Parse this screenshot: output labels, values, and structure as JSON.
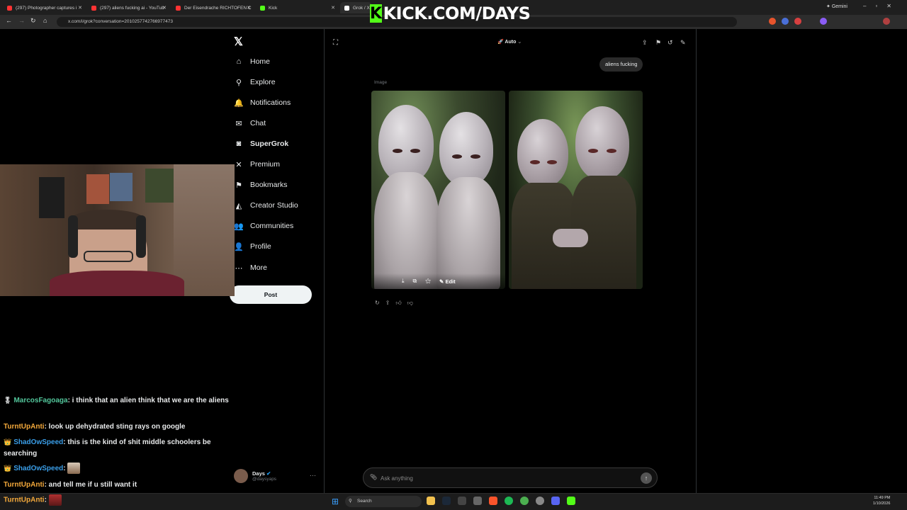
{
  "browser": {
    "tabs": [
      {
        "label": "(297) Photographer captures i",
        "color": "#ff3333"
      },
      {
        "label": "(297) aliens fucking ai - YouTub",
        "color": "#ff3333"
      },
      {
        "label": "Der Eisendrache RICHTOFEN C",
        "color": "#ff3333"
      },
      {
        "label": "Kick",
        "color": "#53fc18"
      },
      {
        "label": "Grok / X",
        "color": "#ffffff"
      }
    ],
    "url": "x.com/i/grok?conversation=2010257742766977473",
    "gemini_label": "Gemini"
  },
  "stream_overlay": {
    "banner_text": "KICK.COM/DAYS",
    "banner_k": "K"
  },
  "sidebar": {
    "logo": "𝕏",
    "items": [
      {
        "label": "Home",
        "icon": "home-icon",
        "glyph": "⌂"
      },
      {
        "label": "Explore",
        "icon": "search-icon",
        "glyph": "⚲"
      },
      {
        "label": "Notifications",
        "icon": "bell-icon",
        "glyph": "🔔"
      },
      {
        "label": "Chat",
        "icon": "mail-icon",
        "glyph": "✉"
      },
      {
        "label": "SuperGrok",
        "icon": "grok-icon",
        "glyph": "◙"
      },
      {
        "label": "Premium",
        "icon": "x-icon",
        "glyph": "✕"
      },
      {
        "label": "Bookmarks",
        "icon": "bookmark-icon",
        "glyph": "⚑"
      },
      {
        "label": "Creator Studio",
        "icon": "creator-icon",
        "glyph": "◭"
      },
      {
        "label": "Communities",
        "icon": "communities-icon",
        "glyph": "👥"
      },
      {
        "label": "Profile",
        "icon": "person-icon",
        "glyph": "👤"
      },
      {
        "label": "More",
        "icon": "more-icon",
        "glyph": "⋯"
      }
    ],
    "post_label": "Post",
    "profile": {
      "name": "Days",
      "handle": "@daysyaps"
    }
  },
  "grok": {
    "model": "Auto",
    "user_message": "aliens fucking",
    "image_label": "Image",
    "edit_label": "Edit",
    "ask_placeholder": "Ask anything"
  },
  "chat": {
    "messages": [
      {
        "user": "MarcosFagoaga",
        "color": "#53c79c",
        "badge": "🎖",
        "text": ": i think that an alien think that we are the aliens"
      },
      {
        "user": "TurntUpAnti",
        "color": "#f4a93b",
        "badge": "",
        "text": ": look up dehydrated sting rays on google"
      },
      {
        "user": "ShadOwSpeed",
        "color": "#3a9ee8",
        "badge": "👑",
        "text": ": this is the kind of shit middle schoolers be searching"
      },
      {
        "user": "ShadOwSpeed",
        "color": "#3a9ee8",
        "badge": "👑",
        "text": ":"
      },
      {
        "user": "TurntUpAnti",
        "color": "#f4a93b",
        "badge": "",
        "text": ": and tell me if u still want it"
      },
      {
        "user": "TurntUpAnti",
        "color": "#f4a93b",
        "badge": "",
        "text": ":"
      }
    ]
  },
  "taskbar": {
    "search_label": "Search",
    "time": "11:49 PM",
    "date": "1/10/2026"
  }
}
